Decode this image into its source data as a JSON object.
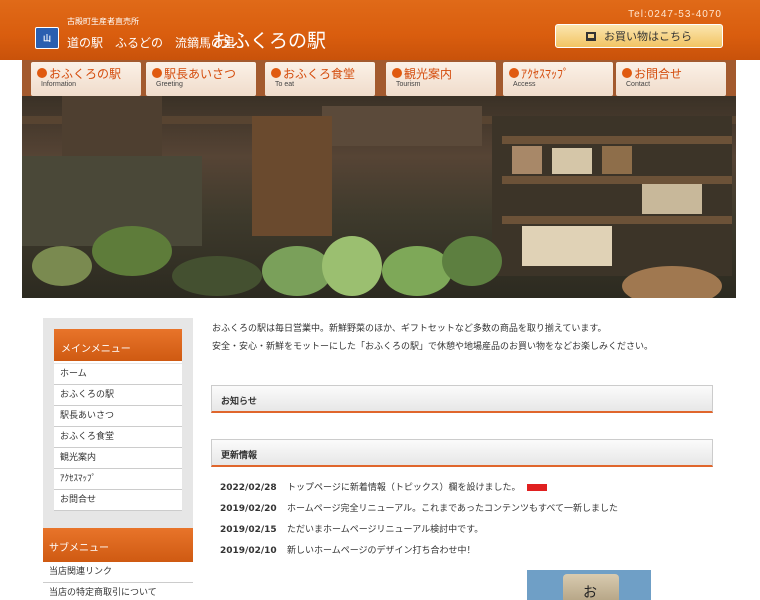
{
  "header": {
    "tagline": "古殿町生産者直売所",
    "sitename": "道の駅　ふるどの　流鏑馬の里",
    "brand": "おふくろの駅",
    "tel": "Tel:0247-53-4070",
    "shop_button": "お買い物はこちら",
    "logo_text": "山"
  },
  "nav": [
    {
      "jp": "おふくろの駅",
      "en": "Information"
    },
    {
      "jp": "駅長あいさつ",
      "en": "Greeting"
    },
    {
      "jp": "おふくろ食堂",
      "en": "To eat"
    },
    {
      "jp": "観光案内",
      "en": "Tourism"
    },
    {
      "jp": "ｱｸｾｽﾏｯﾌﾟ",
      "en": "Access"
    },
    {
      "jp": "お問合せ",
      "en": "Contact"
    }
  ],
  "sidebar": {
    "main_title": "メインメニュー",
    "main_items": [
      "ホーム",
      "おふくろの駅",
      "駅長あいさつ",
      "おふくろ食堂",
      "観光案内",
      "ｱｸｾｽﾏｯﾌﾟ",
      "お問合せ"
    ],
    "sub_title": "サブメニュー",
    "sub_items": [
      "当店関連リンク",
      "当店の特定商取引について"
    ]
  },
  "main": {
    "intro_line1": "おふくろの駅は毎日営業中。新鮮野菜のほか、ギフトセットなど多数の商品を取り揃えています。",
    "intro_line2": "安全・安心・新鮮をモットーにした「おふくろの駅」で休憩や地場産品のお買い物をなどお楽しみください。",
    "notice_title": "お知らせ",
    "updates_title": "更新情報",
    "updates": [
      {
        "date": "2022/02/28",
        "text": "トップページに新着情報（トピックス）欄を設けました。",
        "is_new": true
      },
      {
        "date": "2019/02/20",
        "text": "ホームページ完全リニューアル。これまであったコンテンツもすべて一新しました",
        "is_new": false
      },
      {
        "date": "2019/02/15",
        "text": "ただいまホームページリニューアル検討中です。",
        "is_new": false
      },
      {
        "date": "2019/02/10",
        "text": "新しいホームページのデザイン打ち合わせ中！",
        "is_new": false
      }
    ],
    "image_text": "お"
  },
  "colors": {
    "brand_orange": "#d95d0e",
    "nav_text": "#d44b0b",
    "new_badge": "#e02020"
  }
}
